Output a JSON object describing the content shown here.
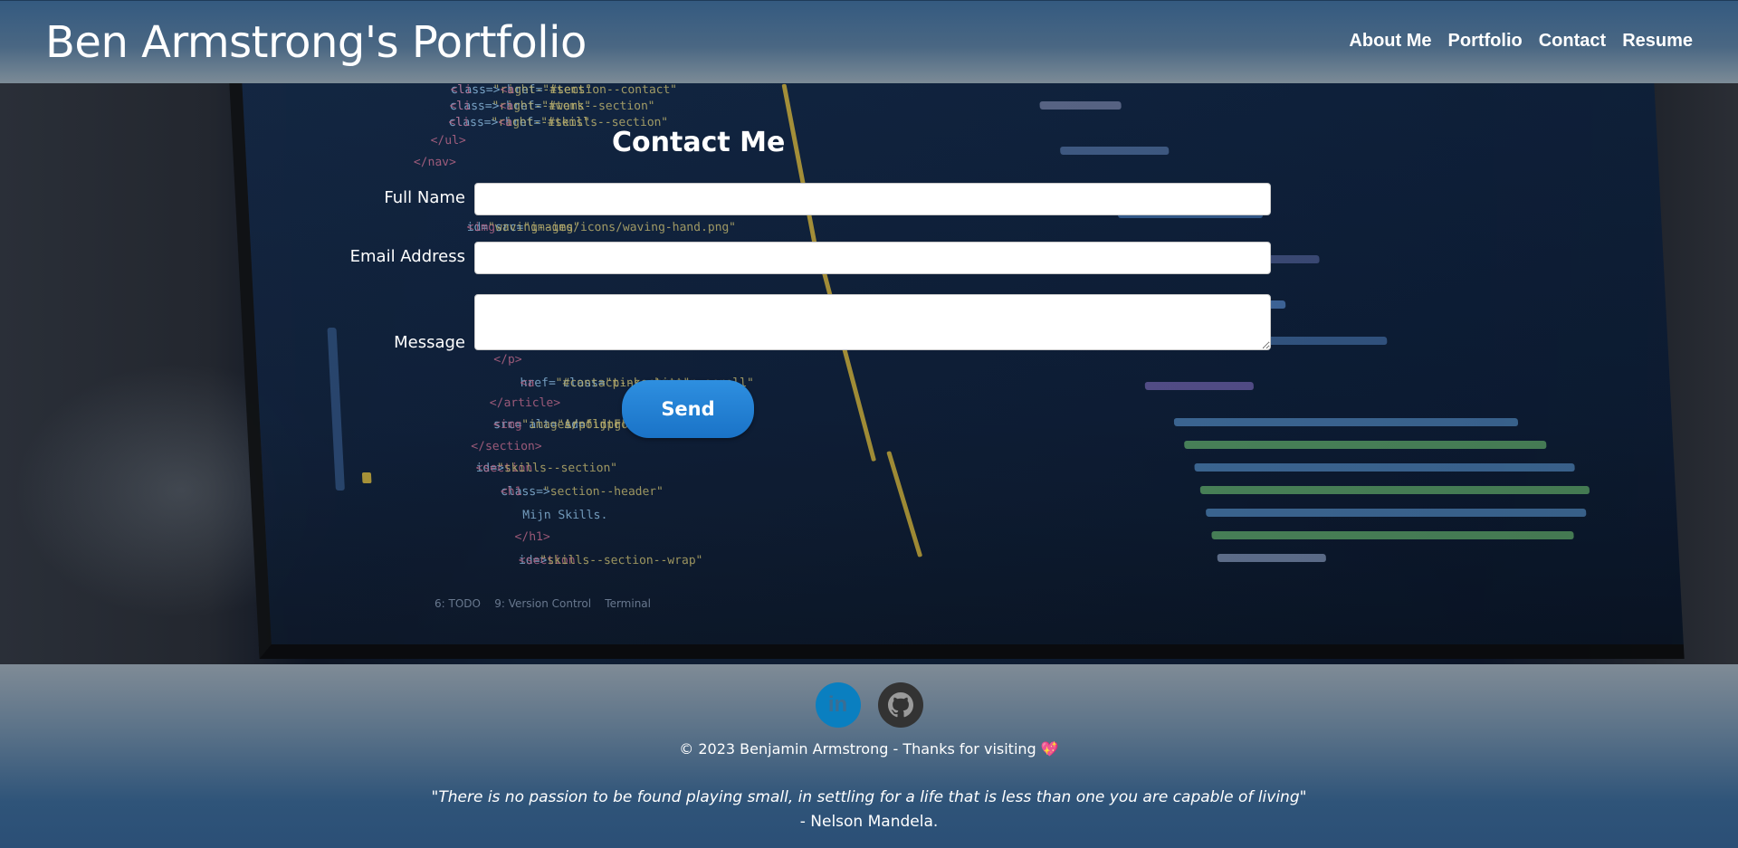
{
  "header": {
    "title": "Ben Armstrong's Portfolio",
    "nav": [
      "About Me",
      "Portfolio",
      "Contact",
      "Resume"
    ]
  },
  "contact": {
    "heading": "Contact Me",
    "fields": {
      "full_name": {
        "label": "Full Name",
        "value": ""
      },
      "email": {
        "label": "Email Address",
        "value": ""
      },
      "message": {
        "label": "Message",
        "value": ""
      }
    },
    "send_label": "Send"
  },
  "footer": {
    "social": [
      {
        "icon": "linkedin-icon",
        "text": "in",
        "color": "#0a7fc0"
      },
      {
        "icon": "github-icon",
        "color": "#333333"
      }
    ],
    "copyright": "© 2023 Benjamin Armstrong - Thanks for visiting",
    "quote": "\"There is no passion to be found playing small, in settling for a life that is less than one you are capable of living\"",
    "author": "- Nelson Mandela."
  },
  "colors": {
    "header_bg": "#345a80",
    "button": "#1a73c7",
    "footer_bg": "#2b4f76"
  }
}
